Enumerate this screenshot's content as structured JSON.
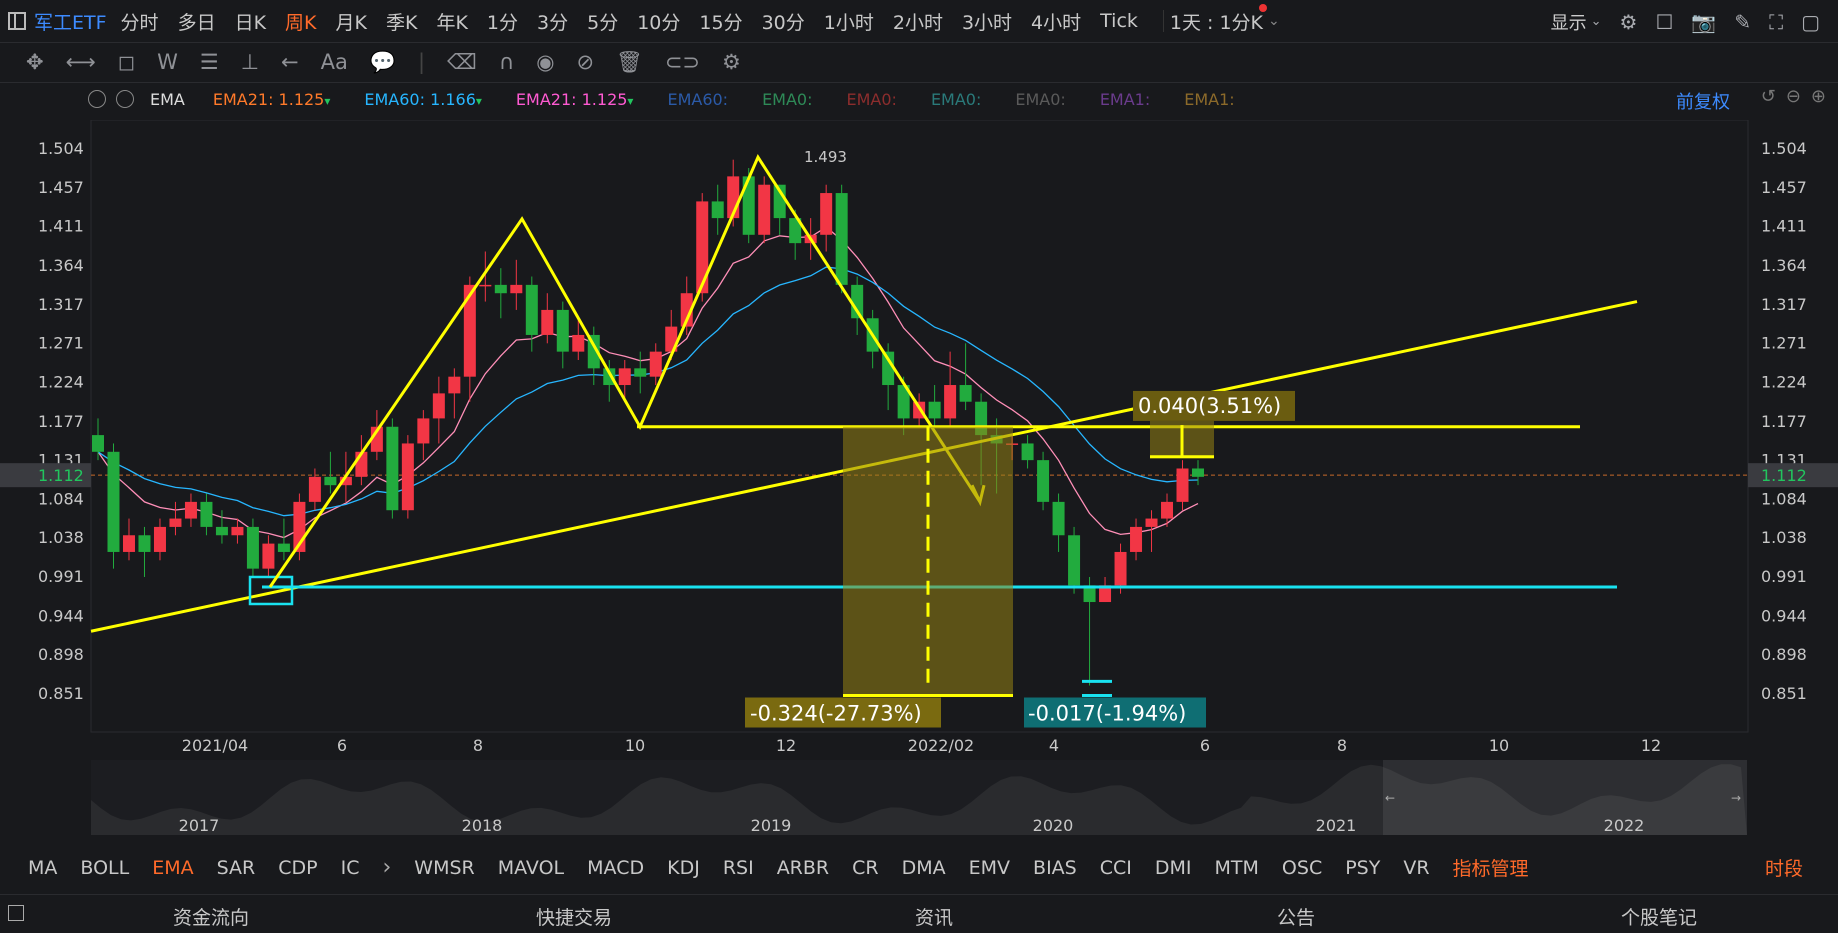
{
  "topbar": {
    "symbol": "军工ETF",
    "periods": [
      "分时",
      "多日",
      "日K",
      "周K",
      "月K",
      "季K",
      "年K",
      "1分",
      "3分",
      "5分",
      "10分",
      "15分",
      "30分",
      "1小时",
      "2小时",
      "3小时",
      "4小时",
      "Tick"
    ],
    "active_period": "周K",
    "range_selector": "1天 : 1分K",
    "display_label": "显示"
  },
  "legend": {
    "indicator": "EMA",
    "items": [
      {
        "name": "EMA21:",
        "value": "1.125",
        "color": "#ff7a2a"
      },
      {
        "name": "EMA60:",
        "value": "1.166",
        "color": "#27b6ff"
      },
      {
        "name": "EMA21:",
        "value": "1.125",
        "color": "#ff5ad2"
      },
      {
        "name": "EMA60:",
        "value": "",
        "color": "#2b5aa8"
      },
      {
        "name": "EMA0:",
        "value": "",
        "color": "#2e8a57"
      },
      {
        "name": "EMA0:",
        "value": "",
        "color": "#8c2d2d"
      },
      {
        "name": "EMA0:",
        "value": "",
        "color": "#2a7a7a"
      },
      {
        "name": "EMA0:",
        "value": "",
        "color": "#5a5a5a"
      },
      {
        "name": "EMA1:",
        "value": "",
        "color": "#6a3b8c"
      },
      {
        "name": "EMA1:",
        "value": "",
        "color": "#8c6a2a"
      }
    ],
    "adjust": "前复权"
  },
  "chart_data": {
    "type": "candlestick",
    "y_ticks": [
      "1.504",
      "1.457",
      "1.411",
      "1.364",
      "1.317",
      "1.271",
      "1.224",
      "1.177",
      "1.131",
      "1.084",
      "1.038",
      "0.991",
      "0.944",
      "0.898",
      "0.851"
    ],
    "ylim": [
      0.82,
      1.52
    ],
    "current_price": "1.112",
    "x_labels": [
      "2021/04",
      "6",
      "8",
      "10",
      "12",
      "2022/02",
      "4",
      "6",
      "8",
      "10",
      "12"
    ],
    "high_label": "1.493",
    "measure_down": "-0.324(-27.73%)",
    "measure_up": "0.040(3.51%)",
    "measure_low": "-0.017(-1.94%)",
    "candles": [
      [
        1.16,
        1.14,
        1.18,
        1.13
      ],
      [
        1.14,
        1.02,
        1.15,
        1.0
      ],
      [
        1.02,
        1.04,
        1.06,
        1.01
      ],
      [
        1.04,
        1.02,
        1.05,
        0.99
      ],
      [
        1.02,
        1.05,
        1.06,
        1.01
      ],
      [
        1.05,
        1.06,
        1.08,
        1.04
      ],
      [
        1.06,
        1.08,
        1.09,
        1.05
      ],
      [
        1.08,
        1.05,
        1.09,
        1.04
      ],
      [
        1.05,
        1.04,
        1.07,
        1.03
      ],
      [
        1.04,
        1.05,
        1.06,
        1.03
      ],
      [
        1.05,
        1.0,
        1.06,
        0.99
      ],
      [
        1.0,
        1.03,
        1.04,
        0.99
      ],
      [
        1.03,
        1.02,
        1.06,
        1.01
      ],
      [
        1.02,
        1.08,
        1.09,
        1.01
      ],
      [
        1.08,
        1.11,
        1.12,
        1.07
      ],
      [
        1.11,
        1.1,
        1.14,
        1.09
      ],
      [
        1.1,
        1.11,
        1.14,
        1.08
      ],
      [
        1.11,
        1.14,
        1.16,
        1.1
      ],
      [
        1.14,
        1.17,
        1.19,
        1.13
      ],
      [
        1.17,
        1.07,
        1.18,
        1.06
      ],
      [
        1.07,
        1.15,
        1.16,
        1.06
      ],
      [
        1.15,
        1.18,
        1.19,
        1.13
      ],
      [
        1.18,
        1.21,
        1.23,
        1.15
      ],
      [
        1.21,
        1.23,
        1.24,
        1.18
      ],
      [
        1.23,
        1.34,
        1.35,
        1.2
      ],
      [
        1.34,
        1.34,
        1.38,
        1.32
      ],
      [
        1.34,
        1.33,
        1.36,
        1.3
      ],
      [
        1.33,
        1.34,
        1.37,
        1.31
      ],
      [
        1.34,
        1.28,
        1.35,
        1.26
      ],
      [
        1.28,
        1.31,
        1.33,
        1.27
      ],
      [
        1.31,
        1.26,
        1.32,
        1.24
      ],
      [
        1.26,
        1.28,
        1.3,
        1.25
      ],
      [
        1.28,
        1.24,
        1.29,
        1.22
      ],
      [
        1.24,
        1.22,
        1.25,
        1.2
      ],
      [
        1.22,
        1.24,
        1.25,
        1.2
      ],
      [
        1.24,
        1.23,
        1.26,
        1.21
      ],
      [
        1.23,
        1.26,
        1.27,
        1.22
      ],
      [
        1.26,
        1.29,
        1.31,
        1.25
      ],
      [
        1.29,
        1.33,
        1.35,
        1.28
      ],
      [
        1.33,
        1.44,
        1.45,
        1.32
      ],
      [
        1.44,
        1.42,
        1.46,
        1.4
      ],
      [
        1.42,
        1.47,
        1.49,
        1.41
      ],
      [
        1.47,
        1.4,
        1.48,
        1.39
      ],
      [
        1.4,
        1.46,
        1.47,
        1.39
      ],
      [
        1.46,
        1.42,
        1.46,
        1.4
      ],
      [
        1.42,
        1.39,
        1.43,
        1.37
      ],
      [
        1.39,
        1.4,
        1.42,
        1.37
      ],
      [
        1.4,
        1.45,
        1.46,
        1.38
      ],
      [
        1.45,
        1.34,
        1.46,
        1.33
      ],
      [
        1.34,
        1.3,
        1.35,
        1.28
      ],
      [
        1.3,
        1.26,
        1.31,
        1.24
      ],
      [
        1.26,
        1.22,
        1.27,
        1.19
      ],
      [
        1.22,
        1.18,
        1.23,
        1.16
      ],
      [
        1.18,
        1.2,
        1.21,
        1.17
      ],
      [
        1.2,
        1.18,
        1.22,
        1.17
      ],
      [
        1.18,
        1.22,
        1.26,
        1.17
      ],
      [
        1.22,
        1.2,
        1.27,
        1.19
      ],
      [
        1.2,
        1.16,
        1.21,
        1.1
      ],
      [
        1.16,
        1.15,
        1.18,
        1.09
      ],
      [
        1.15,
        1.15,
        1.16,
        1.13
      ],
      [
        1.15,
        1.13,
        1.16,
        1.12
      ],
      [
        1.13,
        1.08,
        1.14,
        1.07
      ],
      [
        1.08,
        1.04,
        1.09,
        1.02
      ],
      [
        1.04,
        0.98,
        1.05,
        0.97
      ],
      [
        0.98,
        0.96,
        0.99,
        0.86
      ],
      [
        0.96,
        0.98,
        0.99,
        0.96
      ],
      [
        0.98,
        1.02,
        1.03,
        0.97
      ],
      [
        1.02,
        1.05,
        1.06,
        1.01
      ],
      [
        1.05,
        1.06,
        1.07,
        1.02
      ],
      [
        1.06,
        1.08,
        1.09,
        1.05
      ],
      [
        1.08,
        1.12,
        1.13,
        1.07
      ],
      [
        1.12,
        1.11,
        1.13,
        1.1
      ]
    ]
  },
  "navigator": {
    "years": [
      "2017",
      "2018",
      "2019",
      "2020",
      "2021",
      "2022"
    ]
  },
  "indicators": {
    "items": [
      "MA",
      "BOLL",
      "EMA",
      "SAR",
      "CDP",
      "IC",
      "WMSR",
      "MAVOL",
      "MACD",
      "KDJ",
      "RSI",
      "ARBR",
      "CR",
      "DMA",
      "EMV",
      "BIAS",
      "CCI",
      "DMI",
      "MTM",
      "OSC",
      "PSY",
      "VR"
    ],
    "active": "EMA",
    "manage": "指标管理",
    "period_label": "时段"
  },
  "bottom": {
    "tabs": [
      "资金流向",
      "快捷交易",
      "资讯",
      "公告",
      "个股笔记"
    ]
  },
  "colors": {
    "up": "#f23645",
    "down": "#22ab3e",
    "accent": "#ff6a2a",
    "blue": "#3d8bff",
    "yellow": "#ffff00",
    "cyan": "#19e2f0"
  }
}
